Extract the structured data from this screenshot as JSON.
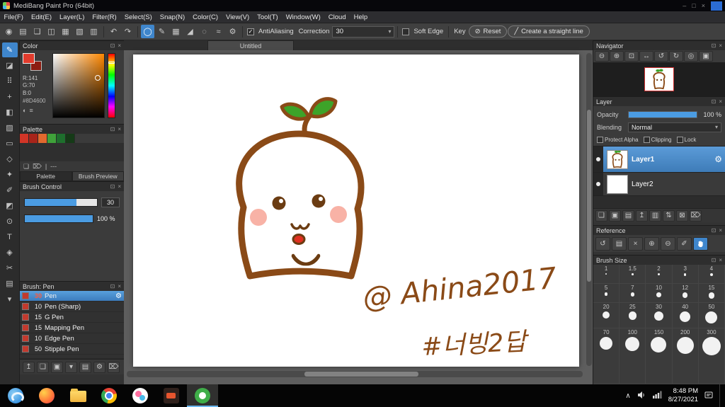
{
  "titlebar": {
    "title": "MediBang Paint Pro (64bit)",
    "controls": [
      "–",
      "□",
      "×"
    ]
  },
  "menubar": {
    "items": [
      "File(F)",
      "Edit(E)",
      "Layer(L)",
      "Filter(R)",
      "Select(S)",
      "Snap(N)",
      "Color(C)",
      "View(V)",
      "Tool(T)",
      "Window(W)",
      "Cloud",
      "Help"
    ]
  },
  "icons": {
    "popout": "⊡",
    "close": "×",
    "gear": "⚙",
    "dropdown": "▾",
    "check": "✓",
    "reset": "⊘",
    "slash": "╱",
    "caret_up": "∧",
    "eye": "●",
    "separator": "|"
  },
  "toolbar": {
    "icons_left": [
      {
        "name": "color-sync-icon",
        "glyph": "◉"
      },
      {
        "name": "save-icon",
        "glyph": "▤"
      },
      {
        "name": "comment-icon",
        "glyph": "❏"
      },
      {
        "name": "share-icon",
        "glyph": "◫"
      },
      {
        "name": "layout-1-icon",
        "glyph": "▦"
      },
      {
        "name": "layout-2-icon",
        "glyph": "▧"
      },
      {
        "name": "layout-3-icon",
        "glyph": "▥"
      }
    ],
    "undo_glyph": "↶",
    "redo_glyph": "↷",
    "brush_icons": [
      {
        "name": "brush-shape-circle-icon",
        "glyph": "◯"
      },
      {
        "name": "pen-tip-icon",
        "glyph": "✎"
      },
      {
        "name": "grid-snap-icon",
        "glyph": "▦"
      },
      {
        "name": "perspective-snap-icon",
        "glyph": "◢"
      },
      {
        "name": "circle-snap-icon",
        "glyph": "◌"
      },
      {
        "name": "curve-snap-icon",
        "glyph": "≈"
      },
      {
        "name": "snap-settings-icon",
        "glyph": "⚙"
      }
    ],
    "antialiasing_label": "AntiAliasing",
    "correction_label": "Correction",
    "correction_value": "30",
    "soft_edge_label": "Soft Edge",
    "key_label": "Key",
    "reset_label": "Reset",
    "straight_line_label": "Create a straight line"
  },
  "toolstrip": {
    "tools": [
      {
        "name": "brush-tool",
        "glyph": "✎"
      },
      {
        "name": "eraser-tool",
        "glyph": "◪"
      },
      {
        "name": "smudge-tool",
        "glyph": "⠿"
      },
      {
        "name": "move-tool",
        "glyph": "+"
      },
      {
        "name": "fill-tool",
        "glyph": "◧"
      },
      {
        "name": "gradient-tool",
        "glyph": "▨"
      },
      {
        "name": "select-tool",
        "glyph": "▭"
      },
      {
        "name": "lasso-tool",
        "glyph": "◇"
      },
      {
        "name": "magic-wand-tool",
        "glyph": "✦"
      },
      {
        "name": "select-pen-tool",
        "glyph": "✐"
      },
      {
        "name": "select-eraser-tool",
        "glyph": "◩"
      },
      {
        "name": "operation-tool",
        "glyph": "⊙"
      },
      {
        "name": "text-tool",
        "glyph": "T"
      },
      {
        "name": "eyedropper-tool",
        "glyph": "◈"
      },
      {
        "name": "scissors-tool",
        "glyph": "✂"
      },
      {
        "name": "divide-tool",
        "glyph": "▤"
      },
      {
        "name": "scroll-more-icon",
        "glyph": "▾"
      }
    ]
  },
  "color_panel": {
    "title": "Color",
    "r": "R:141",
    "g": "G:70",
    "b": "B:0",
    "hex": "#8D4600"
  },
  "palette_panel": {
    "title": "Palette",
    "swatches": [
      "#d23527",
      "#a8241a",
      "#e2692e",
      "#3fa23a",
      "#1e6f2d",
      "#153a17"
    ],
    "separator_text": "---",
    "tabs": [
      "Palette",
      "Brush Preview"
    ]
  },
  "brush_control": {
    "title": "Brush Control",
    "size_value": "30",
    "opacity_value": "100 %"
  },
  "brush_panel": {
    "title": "Brush: Pen",
    "brushes": [
      {
        "size": "30",
        "name": "Pen"
      },
      {
        "size": "10",
        "name": "Pen (Sharp)"
      },
      {
        "size": "15",
        "name": "G Pen"
      },
      {
        "size": "15",
        "name": "Mapping Pen"
      },
      {
        "size": "10",
        "name": "Edge Pen"
      },
      {
        "size": "50",
        "name": "Stipple Pen"
      }
    ]
  },
  "left_footer": {
    "icons": [
      {
        "name": "upload-brush-icon",
        "glyph": "↥"
      },
      {
        "name": "new-brush-icon",
        "glyph": "❏"
      },
      {
        "name": "duplicate-brush-icon",
        "glyph": "▣"
      },
      {
        "name": "brush-menu-icon",
        "glyph": "▾"
      },
      {
        "name": "brush-folder-icon",
        "glyph": "▤"
      },
      {
        "name": "brush-settings-icon",
        "glyph": "⚙"
      },
      {
        "name": "delete-brush-icon",
        "glyph": "⌦"
      }
    ]
  },
  "canvas": {
    "tab_title": "Untitled",
    "signature": "@ Ahina2017",
    "hashtag": "#너빙2답"
  },
  "navigator": {
    "title": "Navigator",
    "icons": [
      {
        "name": "zoom-out-icon",
        "glyph": "⊖"
      },
      {
        "name": "zoom-in-icon",
        "glyph": "⊕"
      },
      {
        "name": "zoom-100-icon",
        "glyph": "⊡"
      },
      {
        "name": "fit-window-icon",
        "glyph": "↔"
      },
      {
        "name": "rotate-left-icon",
        "glyph": "↺"
      },
      {
        "name": "rotate-right-icon",
        "glyph": "↻"
      },
      {
        "name": "reset-rotation-icon",
        "glyph": "◎"
      },
      {
        "name": "thumbnail-mode-icon",
        "glyph": "▣"
      }
    ]
  },
  "layer_panel": {
    "title": "Layer",
    "opacity_label": "Opacity",
    "opacity_value": "100 %",
    "blending_label": "Blending",
    "blending_value": "Normal",
    "protect_alpha_label": "Protect Alpha",
    "clipping_label": "Clipping",
    "lock_label": "Lock",
    "layers": [
      {
        "name": "Layer1"
      },
      {
        "name": "Layer2"
      }
    ],
    "footer_icons": [
      {
        "name": "add-layer-icon",
        "glyph": "❏"
      },
      {
        "name": "add-folder-icon",
        "glyph": "▣"
      },
      {
        "name": "duplicate-layer-icon",
        "glyph": "▤"
      },
      {
        "name": "transfer-layer-icon",
        "glyph": "↥"
      },
      {
        "name": "merge-layer-icon",
        "glyph": "▥"
      },
      {
        "name": "layer-order-icon",
        "glyph": "⇅"
      },
      {
        "name": "clear-layer-icon",
        "glyph": "⊠"
      },
      {
        "name": "delete-layer-icon",
        "glyph": "⌦"
      }
    ]
  },
  "reference_panel": {
    "title": "Reference",
    "icons": [
      {
        "name": "refresh-icon",
        "glyph": "↺"
      },
      {
        "name": "open-file-icon",
        "glyph": "▤"
      },
      {
        "name": "close-image-icon",
        "glyph": "×"
      },
      {
        "name": "ref-zoom-in-icon",
        "glyph": "⊕"
      },
      {
        "name": "ref-zoom-out-icon",
        "glyph": "⊖"
      },
      {
        "name": "ref-eyedropper-icon",
        "glyph": "✐"
      }
    ]
  },
  "brush_size_panel": {
    "title": "Brush Size",
    "sizes": [
      "1",
      "1.5",
      "2",
      "3",
      "4",
      "5",
      "7",
      "10",
      "12",
      "15",
      "20",
      "25",
      "30",
      "40",
      "50",
      "70",
      "100",
      "150",
      "200",
      "300"
    ]
  },
  "taskbar": {
    "apps": [
      "edge",
      "firefox",
      "file-explorer",
      "chrome",
      "medibang-cloud",
      "paint-tool",
      "medibang-paint-active"
    ],
    "time": "8:48 PM",
    "date": "8/27/2021"
  },
  "colors": {
    "accent_blue": "#3f86cc",
    "selection_blue": "#4a8fd0",
    "stroke_brown": "#8a4a17",
    "leaf_green": "#3da329",
    "cheek_pink": "#f8b2a6",
    "mouth_red": "#e03020",
    "current_color_hex": "#8D4600"
  }
}
